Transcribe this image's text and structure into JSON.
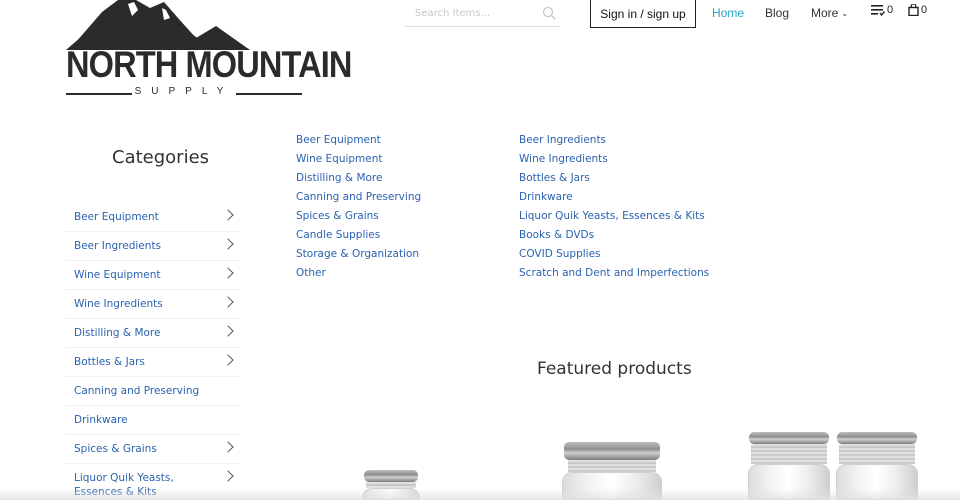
{
  "brand": {
    "name": "NORTH MOUNTAIN",
    "tagline": "SUPPLY"
  },
  "header": {
    "search_placeholder": "Search Items...",
    "signin_label": "Sign in / sign up",
    "nav": {
      "home": "Home",
      "blog": "Blog",
      "more": "More"
    },
    "list_count": "0",
    "cart_count": "0",
    "accent_color": "#23a5c4"
  },
  "categories": {
    "title": "Categories",
    "items": [
      {
        "label": "Beer Equipment"
      },
      {
        "label": "Beer Ingredients"
      },
      {
        "label": "Wine Equipment"
      },
      {
        "label": "Wine Ingredients"
      },
      {
        "label": "Distilling & More"
      },
      {
        "label": "Bottles & Jars"
      },
      {
        "label": "Canning and Preserving"
      },
      {
        "label": "Drinkware"
      },
      {
        "label": "Spices & Grains"
      },
      {
        "label": "Liquor Quik Yeasts, Essences & Kits"
      }
    ]
  },
  "links": {
    "col1": [
      "Beer Equipment",
      "Wine Equipment",
      "Distilling & More",
      "Canning and Preserving",
      "Spices & Grains",
      "Candle Supplies",
      "Storage & Organization",
      "Other"
    ],
    "col2": [
      "Beer Ingredients",
      "Wine Ingredients",
      "Bottles & Jars",
      "Drinkware",
      "Liquor Quik Yeasts, Essences & Kits",
      "Books & DVDs",
      "COVID Supplies",
      "Scratch and Dent and Imperfections"
    ]
  },
  "featured": {
    "title": "Featured products"
  },
  "link_color": "#2a62b0"
}
